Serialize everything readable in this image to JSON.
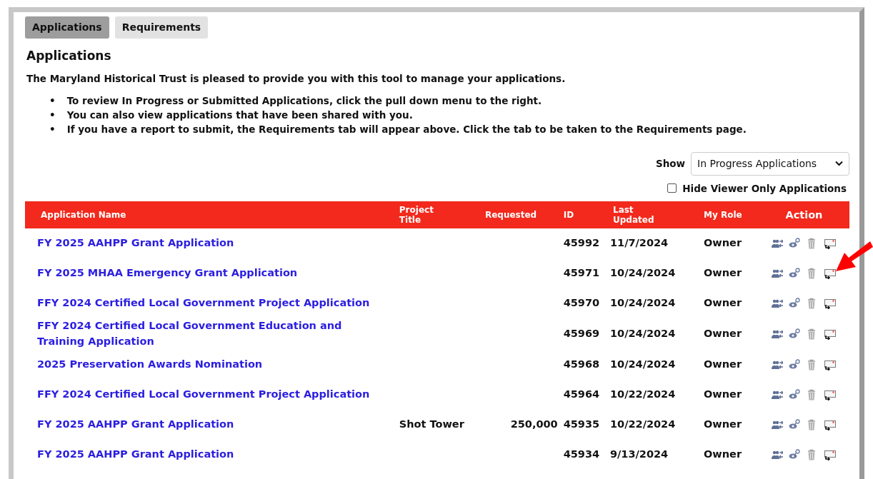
{
  "tabs": [
    {
      "label": "Applications",
      "selected": true
    },
    {
      "label": "Requirements",
      "selected": false
    }
  ],
  "heading": "Applications",
  "intro": "The Maryland Historical Trust is pleased to provide you with this tool to manage your applications.",
  "bullets": [
    {
      "marker": "•",
      "text": "To review In Progress or Submitted Applications, click the pull down menu to the right."
    },
    {
      "marker": "•",
      "text": "You can also view applications that have been shared with you."
    },
    {
      "marker": "•",
      "text": "If you have a report to submit, the **Requirements** tab will appear above. Click the tab to be taken to the Requirements page."
    }
  ],
  "show": {
    "label": "Show",
    "value": "In Progress Applications"
  },
  "hide_viewer": {
    "label": "Hide Viewer Only Applications",
    "checked": false
  },
  "table": {
    "columns": [
      "Application Name",
      "Project Title",
      "Requested",
      "ID",
      "Last Updated",
      "My Role",
      "Action"
    ],
    "rows": [
      {
        "name": "FY 2025 AAHPP Grant Application",
        "project_title": "",
        "requested": "",
        "id": "45992",
        "updated": "11/7/2024",
        "role": "Owner"
      },
      {
        "name": "FY 2025 MHAA Emergency Grant Application",
        "project_title": "",
        "requested": "",
        "id": "45971",
        "updated": "10/24/2024",
        "role": "Owner"
      },
      {
        "name": "FFY 2024 Certified Local Government Project Application",
        "project_title": "",
        "requested": "",
        "id": "45970",
        "updated": "10/24/2024",
        "role": "Owner"
      },
      {
        "name": "FFY 2024 Certified Local Government Education and Training Application",
        "project_title": "",
        "requested": "",
        "id": "45969",
        "updated": "10/24/2024",
        "role": "Owner"
      },
      {
        "name": "2025 Preservation Awards Nomination",
        "project_title": "",
        "requested": "",
        "id": "45968",
        "updated": "10/24/2024",
        "role": "Owner"
      },
      {
        "name": "FFY 2024 Certified Local Government Project Application",
        "project_title": "",
        "requested": "",
        "id": "45964",
        "updated": "10/22/2024",
        "role": "Owner"
      },
      {
        "name": "FY 2025 AAHPP Grant Application",
        "project_title": "Shot Tower",
        "requested": "250,000",
        "id": "45935",
        "updated": "10/22/2024",
        "role": "Owner"
      },
      {
        "name": "FY 2025 AAHPP Grant Application",
        "project_title": "",
        "requested": "",
        "id": "45934",
        "updated": "9/13/2024",
        "role": "Owner"
      }
    ]
  }
}
